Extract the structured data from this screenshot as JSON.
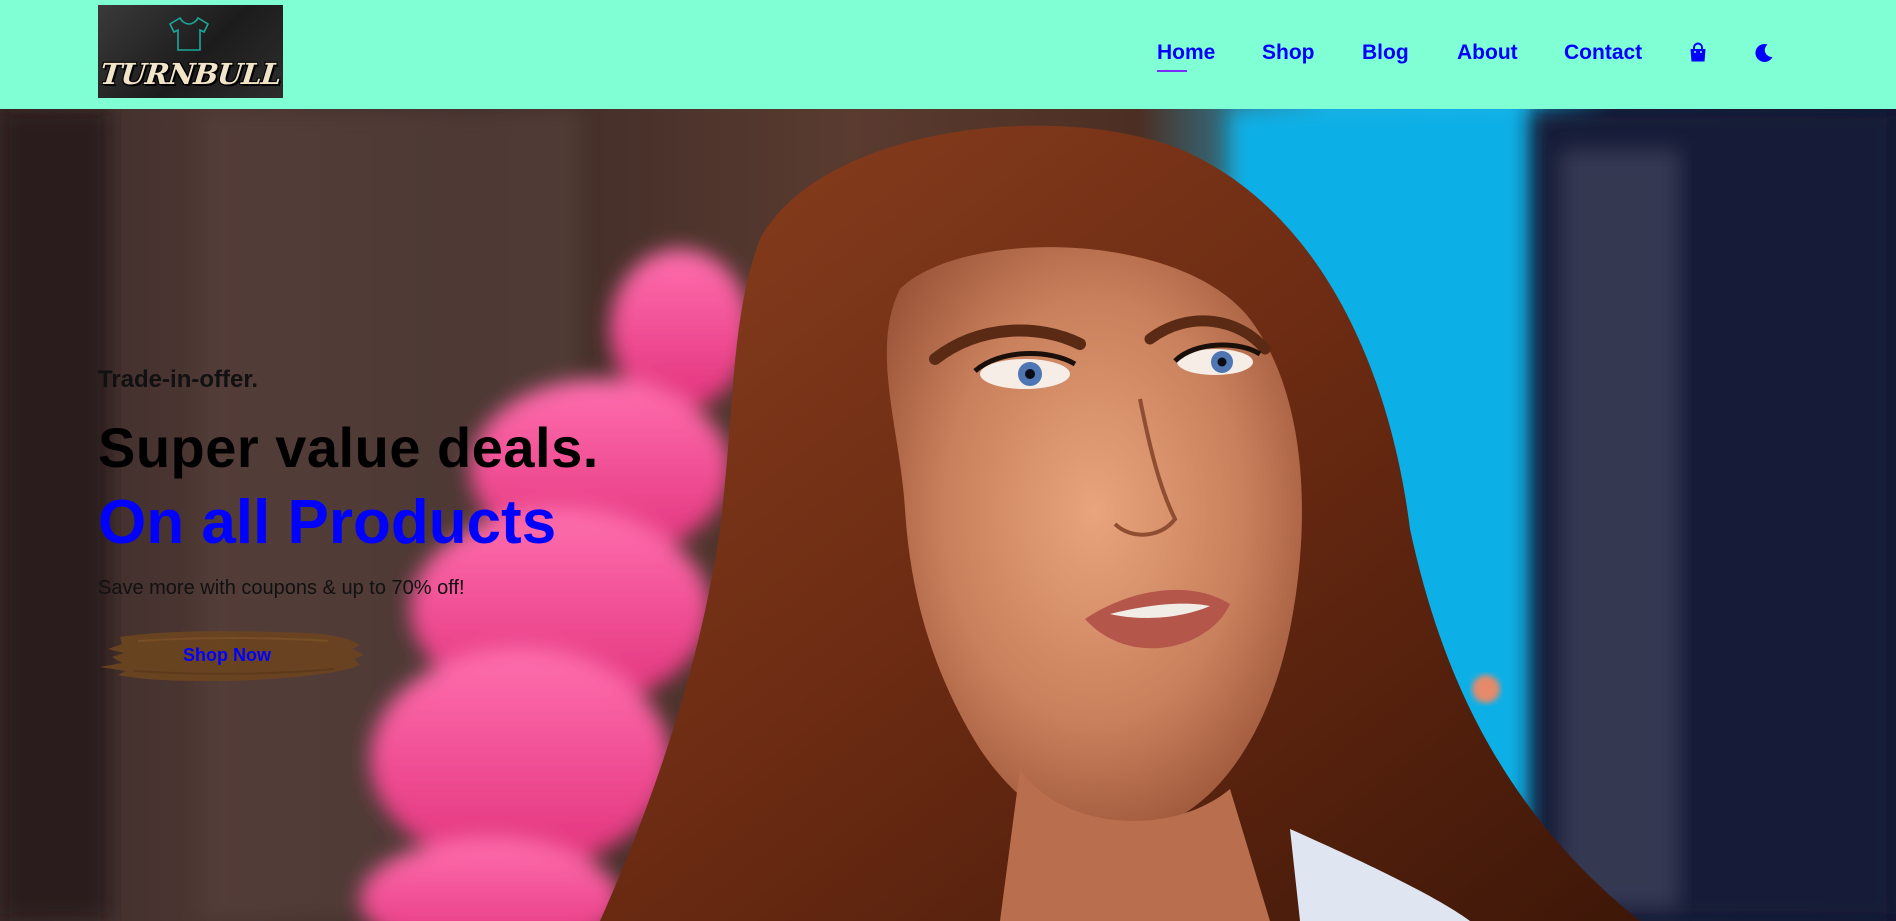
{
  "brand": {
    "logo_text": "TURNBULL",
    "logo_icon": "t-shirt-icon"
  },
  "nav": {
    "items": [
      {
        "label": "Home",
        "active": true
      },
      {
        "label": "Shop",
        "active": false
      },
      {
        "label": "Blog",
        "active": false
      },
      {
        "label": "About",
        "active": false
      },
      {
        "label": "Contact",
        "active": false
      }
    ],
    "icons": [
      "shopping-bag-icon",
      "moon-icon"
    ]
  },
  "hero": {
    "eyebrow": "Trade-in-offer.",
    "headline_line1": "Super value deals.",
    "headline_line2": "On all Products",
    "subtext": "Save more with coupons & up to 70% off!",
    "cta_label": "Shop Now"
  },
  "colors": {
    "header_bg": "#80ffd4",
    "link": "#0000ff",
    "active_underline": "#7b2cff",
    "cta_brush": "#6b4420"
  }
}
